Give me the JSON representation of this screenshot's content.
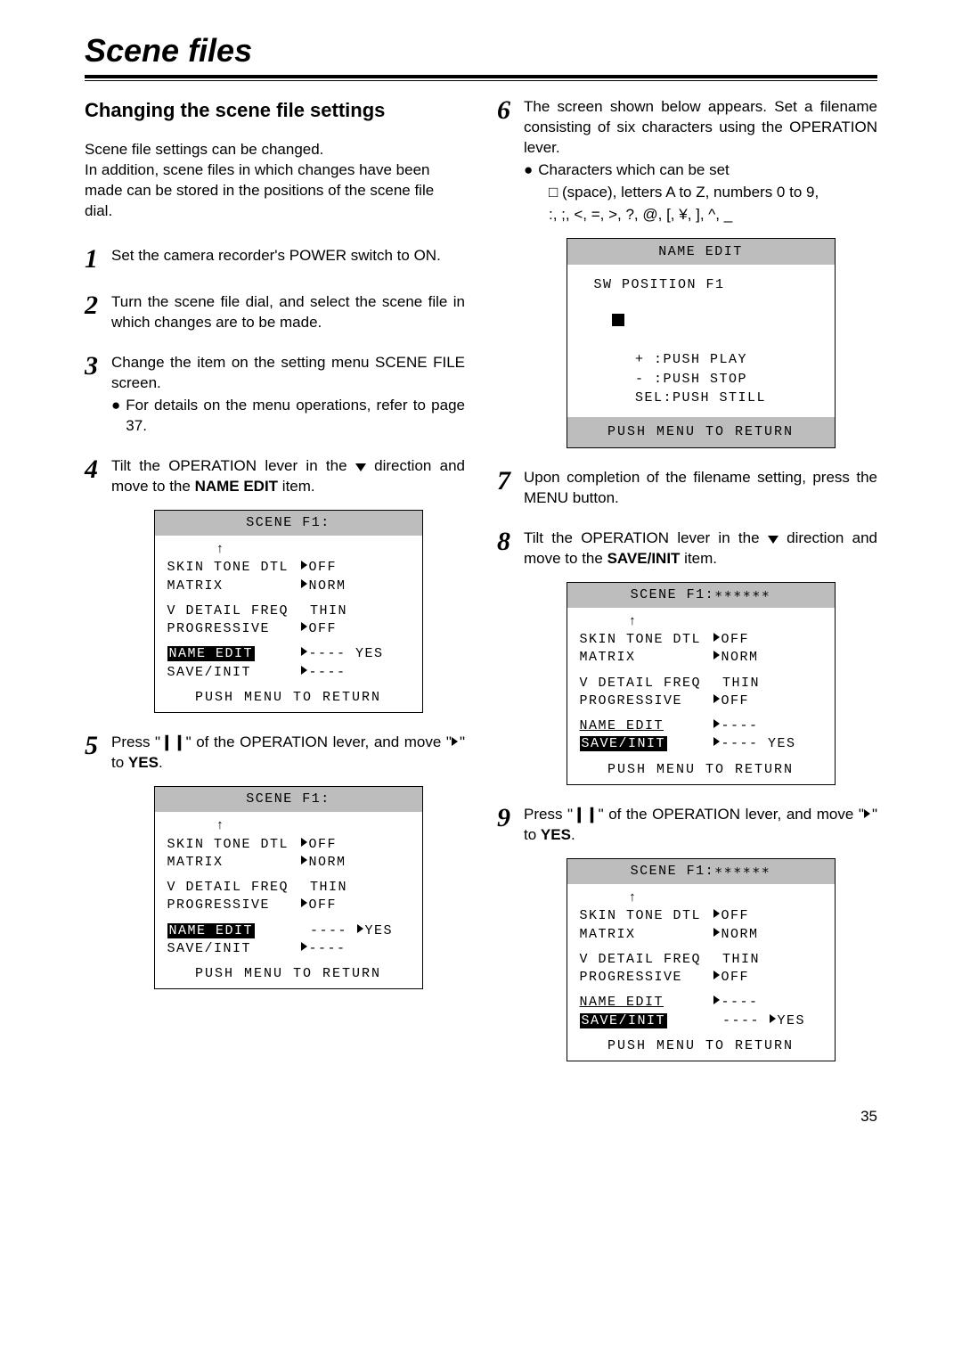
{
  "title": "Scene files",
  "subhead": "Changing the scene file settings",
  "intro_line1": "Scene file settings can be changed.",
  "intro_line2": "In addition, scene files in which changes have been made can be stored in the positions of the scene file dial.",
  "steps": {
    "s1": "Set the camera recorder's POWER switch to ON.",
    "s2": "Turn the scene file dial, and select the scene file in which changes are to be made.",
    "s3": "Change the item on the setting menu SCENE FILE screen.",
    "s3_bullet": "For details on the menu operations, refer to page 37.",
    "s4_pre": "Tilt the OPERATION lever in the ",
    "s4_post": " direction and move to the ",
    "s4_bold": "NAME EDIT",
    "s4_end": " item.",
    "s5_pre": "Press \"",
    "s5_mid": "\" of the OPERATION lever, and move \"",
    "s5_to": "\" to ",
    "s5_bold": "YES",
    "s5_end": ".",
    "s6": "The screen shown below appears. Set a filename consisting of six characters using the OPERATION lever.",
    "s6_bullet_head": "Characters which can be set",
    "s6_charset1": "□ (space), letters A to Z, numbers 0 to 9,",
    "s6_charset2": ":, ;, <, =, >, ?, @, [, ¥, ], ^, _",
    "s7": "Upon completion of the filename setting, press the MENU button.",
    "s8_pre": "Tilt the OPERATION lever in the ",
    "s8_post": " direction and move to the ",
    "s8_bold": "SAVE/INIT",
    "s8_end": " item.",
    "s9_pre": "Press \"",
    "s9_mid": "\" of the OPERATION lever, and move \"",
    "s9_to": "\" to ",
    "s9_bold": "YES",
    "s9_end": "."
  },
  "footer": "PUSH MENU TO RETURN",
  "screenA": {
    "header": "SCENE F1:",
    "rows": {
      "skin": "SKIN TONE DTL",
      "skin_v": "OFF",
      "matrix": "MATRIX",
      "matrix_v": "NORM",
      "vdetail": "V DETAIL FREQ",
      "vdetail_v": "THIN",
      "prog": "PROGRESSIVE",
      "prog_v": "OFF",
      "name": "NAME EDIT",
      "name_v": "---- YES",
      "save": "SAVE/INIT",
      "save_v": "----"
    }
  },
  "screenB": {
    "header": "SCENE F1:",
    "name_v": "----",
    "yes": "YES"
  },
  "nameEditScreen": {
    "header": "NAME EDIT",
    "pos": "SW POSITION F1",
    "l1": "+ :PUSH PLAY",
    "l2": "- :PUSH STOP",
    "l3": "SEL:PUSH STILL"
  },
  "screenC": {
    "header": "SCENE F1:∗∗∗∗∗∗",
    "name_v": "----",
    "save_v": "---- YES"
  },
  "screenD": {
    "header": "SCENE F1:∗∗∗∗∗∗",
    "name_v": "----",
    "save_v": "----",
    "yes": "YES"
  },
  "page_number": "35"
}
